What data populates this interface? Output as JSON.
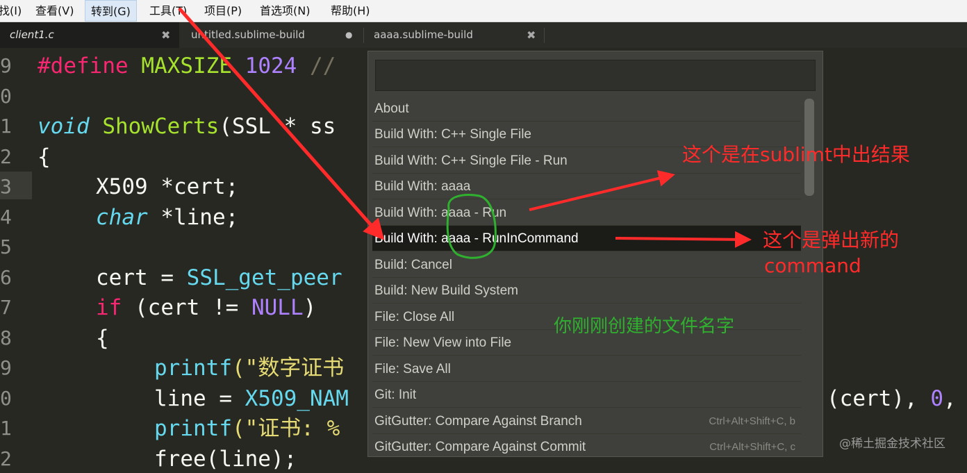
{
  "menubar": {
    "items": [
      "找(I)",
      "查看(V)",
      "转到(G)",
      "工具(T)",
      "项目(P)",
      "首选项(N)",
      "帮助(H)"
    ],
    "active_index": 2
  },
  "tabs": [
    {
      "label": "client1.c",
      "close": "✖"
    },
    {
      "label": "untitled.sublime-build",
      "dot": "●"
    },
    {
      "label": "aaaa.sublime-build",
      "close": "✖"
    }
  ],
  "gutter": {
    "line_numbers": [
      "9",
      "0",
      "1",
      "2",
      "3",
      "4",
      "5",
      "6",
      "7",
      "8",
      "9",
      "0",
      "1",
      "2"
    ],
    "highlight_index": 4
  },
  "code": {
    "l0_define": "#define",
    "l0_name": "MAXSIZE",
    "l0_value": "1024",
    "l0_comment": "//",
    "l2_void": "void",
    "l2_func": "ShowCerts",
    "l2_rest": "(SSL * ss",
    "l3": "{",
    "l4": "X509 *cert;",
    "l5_type": "char",
    "l5_rest": " *line;",
    "l7_a": "cert = ",
    "l7_b": "SSL_get_peer",
    "l8_if": "if",
    "l8_a": " (cert != ",
    "l8_null": "NULL",
    "l8_b": ")",
    "l9": "{",
    "l10_f": "printf",
    "l10_s": "(\"数字证书",
    "l11_a": "line = ",
    "l11_b": "X509_NAM",
    "l11_tail_a": "(cert), ",
    "l11_tail_zero": "0",
    "l11_tail_b": ",",
    "l12_f": "printf",
    "l12_s": "(\"证书: %",
    "l13": "free(line);"
  },
  "palette": {
    "input_value": "",
    "items": [
      {
        "label": "About",
        "shortcut": ""
      },
      {
        "label": "Build With: C++ Single File",
        "shortcut": ""
      },
      {
        "label": "Build With: C++ Single File - Run",
        "shortcut": ""
      },
      {
        "label": "Build With: aaaa",
        "shortcut": ""
      },
      {
        "label": "Build With: aaaa - Run",
        "shortcut": ""
      },
      {
        "label": "Build With: aaaa - RunInCommand",
        "shortcut": ""
      },
      {
        "label": "Build: Cancel",
        "shortcut": ""
      },
      {
        "label": "Build: New Build System",
        "shortcut": ""
      },
      {
        "label": "File: Close All",
        "shortcut": ""
      },
      {
        "label": "File: New View into File",
        "shortcut": ""
      },
      {
        "label": "File: Save All",
        "shortcut": ""
      },
      {
        "label": "Git: Init",
        "shortcut": ""
      },
      {
        "label": "GitGutter: Compare Against Branch",
        "shortcut": "Ctrl+Alt+Shift+C, b"
      },
      {
        "label": "GitGutter: Compare Against Commit",
        "shortcut": "Ctrl+Alt+Shift+C, c"
      }
    ],
    "selected_index": 5
  },
  "annotations": {
    "note1": "这个是在sublimt中出结果",
    "note2_line1": "这个是弹出新的",
    "note2_line2": "command",
    "note3": "你刚刚创建的文件名字"
  },
  "watermark": "@稀土掘金技术社区",
  "colors": {
    "annotation_red": "#ff2a2a",
    "annotation_green": "#2fb02f",
    "editor_bg": "#272822"
  }
}
